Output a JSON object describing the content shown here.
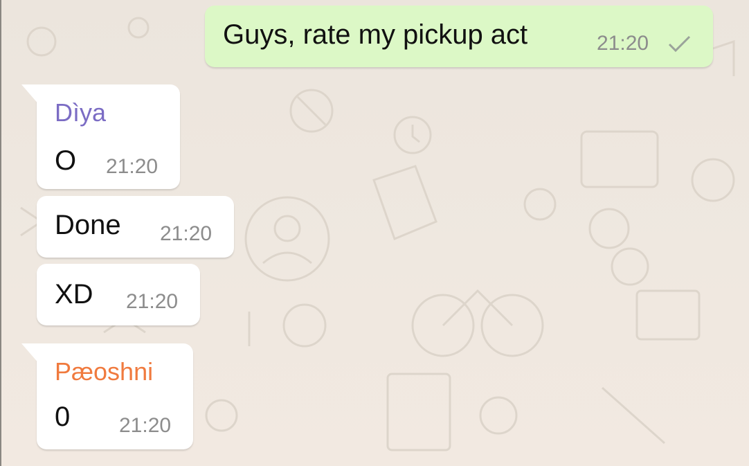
{
  "conversation": {
    "outgoing": [
      {
        "text": "Guys, rate my pickup act",
        "time": "21:20",
        "status_icon": "single-check-icon"
      }
    ],
    "incoming": [
      {
        "sender": "Dìya",
        "text": "O",
        "time": "21:20"
      },
      {
        "text": "Done",
        "time": "21:20"
      },
      {
        "text": "XD",
        "time": "21:20"
      },
      {
        "sender": "Pæoshni",
        "text": "0",
        "time": "21:20"
      }
    ]
  },
  "colors": {
    "outgoing_bubble": "#dcf8c6",
    "incoming_bubble": "#ffffff",
    "sender_diya": "#7b6cc4",
    "sender_paeoshni": "#f07a3e",
    "timestamp": "#8c8c8c",
    "background": "#ece5dd"
  }
}
